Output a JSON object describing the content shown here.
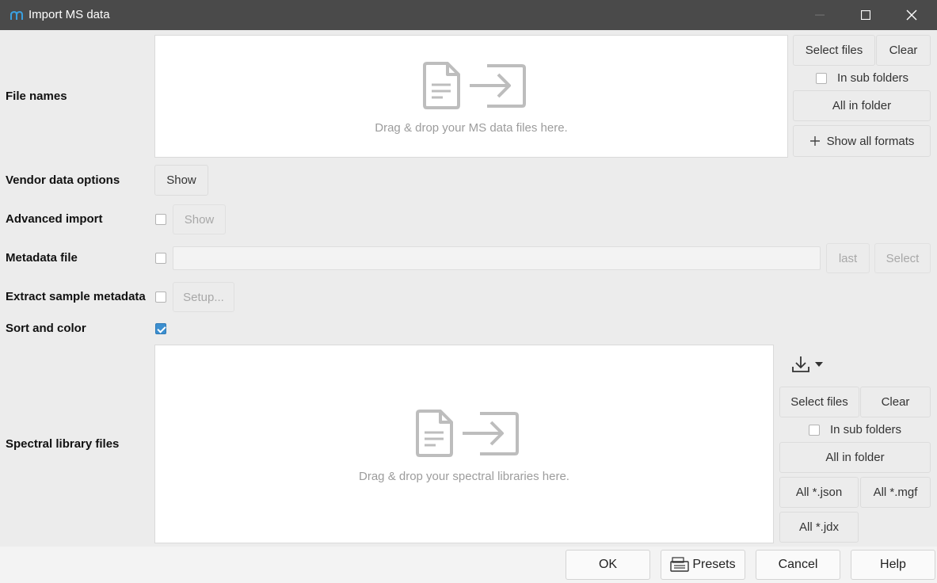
{
  "window": {
    "title": "Import MS data",
    "icons": {
      "app": "app-logo-icon",
      "minimize": "minimize-icon",
      "maximize": "maximize-icon",
      "close": "close-icon"
    }
  },
  "file_names": {
    "label": "File names",
    "drop_text": "Drag & drop your MS data files here.",
    "select_files": "Select files",
    "clear": "Clear",
    "in_sub_folders": "In sub folders",
    "in_sub_folders_checked": false,
    "all_in_folder": "All in folder",
    "show_all_formats": "Show all formats",
    "show_all_formats_icon": "plus-icon"
  },
  "vendor_options": {
    "label": "Vendor data options",
    "show": "Show"
  },
  "advanced_import": {
    "label": "Advanced import",
    "checked": false,
    "show": "Show"
  },
  "metadata_file": {
    "label": "Metadata file",
    "checked": false,
    "value": "",
    "last": "last",
    "select": "Select"
  },
  "extract_metadata": {
    "label": "Extract sample metadata",
    "checked": false,
    "setup": "Setup..."
  },
  "sort_color": {
    "label": "Sort and color",
    "checked": true
  },
  "spectral_library": {
    "label": "Spectral library files",
    "drop_text": "Drag & drop your spectral libraries here.",
    "download_icon": "download-icon",
    "dropdown_icon": "caret-down-icon",
    "select_files": "Select files",
    "clear": "Clear",
    "in_sub_folders": "In sub folders",
    "in_sub_folders_checked": false,
    "all_in_folder": "All in folder",
    "all_json": "All *.json",
    "all_mgf": "All *.mgf",
    "all_jdx": "All *.jdx"
  },
  "footer": {
    "ok": "OK",
    "presets": "Presets",
    "presets_icon": "presets-icon",
    "cancel": "Cancel",
    "help": "Help"
  },
  "colors": {
    "titlebar": "#4a4a4a",
    "accent": "#3c8fd0",
    "background": "#ececec"
  }
}
